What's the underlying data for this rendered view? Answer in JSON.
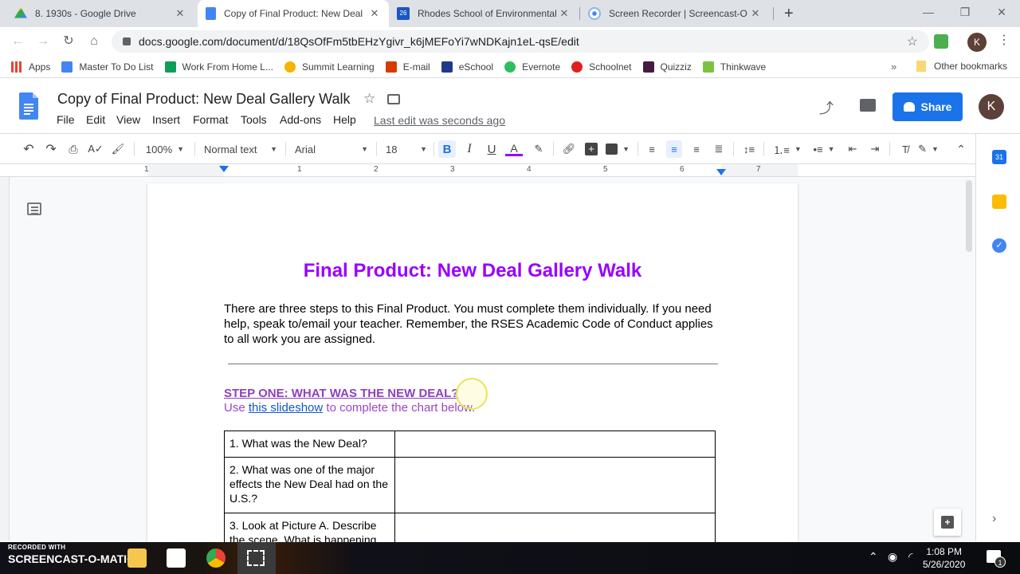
{
  "browser": {
    "tabs": [
      {
        "title": "8. 1930s - Google Drive",
        "icon": "google-drive-icon",
        "active": false
      },
      {
        "title": "Copy of Final Product: New Deal",
        "icon": "google-docs-icon",
        "active": true
      },
      {
        "title": "Rhodes School of Environmental",
        "icon": "calendar-icon",
        "active": false
      },
      {
        "title": "Screen Recorder | Screencast-O",
        "icon": "screencast-icon",
        "active": false
      }
    ],
    "new_tab_label": "+",
    "url": "docs.google.com/document/d/18QsOfFm5tbEHzYgivr_k6jMEFoYi7wNDKajn1eL-qsE/edit",
    "profile_initial": "K",
    "bookmarks": [
      {
        "label": "Apps",
        "color": "#ea4335"
      },
      {
        "label": "Master To Do List",
        "color": "#4285f4"
      },
      {
        "label": "Work From Home L...",
        "color": "#0f9d58"
      },
      {
        "label": "Summit Learning",
        "color": "#f4b400"
      },
      {
        "label": "E-mail",
        "color": "#d83b01"
      },
      {
        "label": "eSchool",
        "color": "#1e3a8a"
      },
      {
        "label": "Evernote",
        "color": "#2dbe60"
      },
      {
        "label": "Schoolnet",
        "color": "#e02020"
      },
      {
        "label": "Quizziz",
        "color": "#461a42"
      },
      {
        "label": "Thinkwave",
        "color": "#7cc242"
      }
    ],
    "bookmarks_overflow": "»",
    "other_bookmarks": "Other bookmarks"
  },
  "docs": {
    "title": "Copy of Final Product: New Deal Gallery Walk",
    "menus": [
      "File",
      "Edit",
      "View",
      "Insert",
      "Format",
      "Tools",
      "Add-ons",
      "Help"
    ],
    "last_edit": "Last edit was seconds ago",
    "share_label": "Share",
    "avatar_initial": "K",
    "toolbar": {
      "zoom": "100%",
      "style": "Normal text",
      "font": "Arial",
      "size": "18",
      "text_color": "#9900ff"
    },
    "ruler_numbers": [
      "1",
      "1",
      "2",
      "3",
      "4",
      "5",
      "6",
      "7"
    ]
  },
  "document": {
    "heading": "Final Product: New Deal Gallery Walk",
    "intro": "There are three steps to this Final Product. You must complete them individually. If you need help, speak to/email your teacher.  Remember, the RSES Academic Code of Conduct applies to all work you are assigned.",
    "step_one_title": "STEP ONE: WHAT WAS THE NEW DEAL?",
    "step_one_prefix": "Use ",
    "step_one_link": "this slideshow",
    "step_one_suffix": " to complete the chart below.",
    "questions": [
      {
        "q": "1. What was the New Deal?",
        "a": ""
      },
      {
        "q": "2. What was one of the major effects the New Deal had on the U.S.?",
        "a": ""
      },
      {
        "q": "3. Look at Picture A. Describe the scene. What is happening",
        "a": ""
      }
    ]
  },
  "taskbar": {
    "recorder_top": "RECORDED WITH",
    "recorder_brand": "SCREENCAST-O-MATIC",
    "time": "1:08 PM",
    "date": "5/26/2020",
    "notification_count": "1"
  }
}
